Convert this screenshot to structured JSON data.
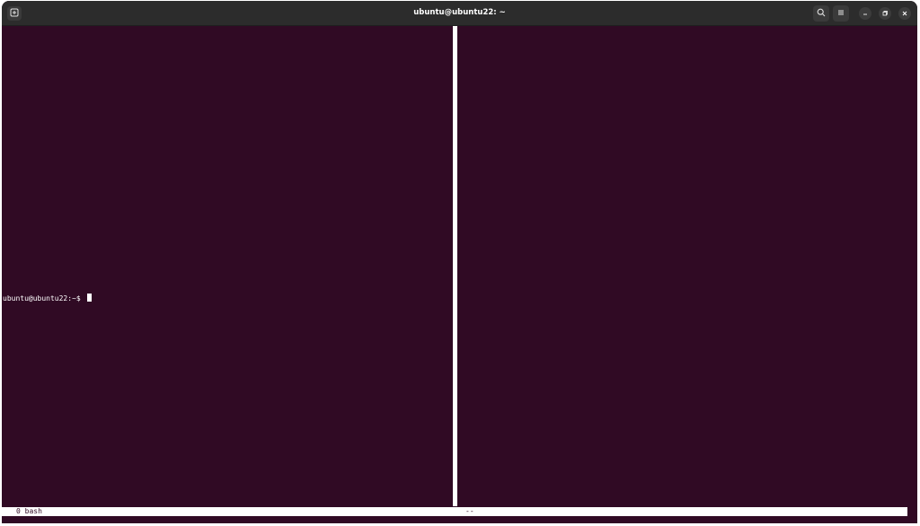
{
  "titlebar": {
    "title": "ubuntu@ubuntu22: ~",
    "icons": {
      "new_tab": "new-tab-icon",
      "search": "search-icon",
      "menu": "hamburger-menu-icon",
      "minimize": "minimize-icon",
      "restore": "restore-icon",
      "close": "close-icon"
    }
  },
  "terminal": {
    "left_pane": {
      "prompt": "ubuntu@ubuntu22:~$ "
    },
    "right_pane": {
      "content": ""
    }
  },
  "statusbar": {
    "left": "0 bash",
    "right": "--"
  },
  "colors": {
    "terminal_bg": "#300a24",
    "titlebar_bg": "#2c2c2c",
    "text": "#ffffff"
  }
}
